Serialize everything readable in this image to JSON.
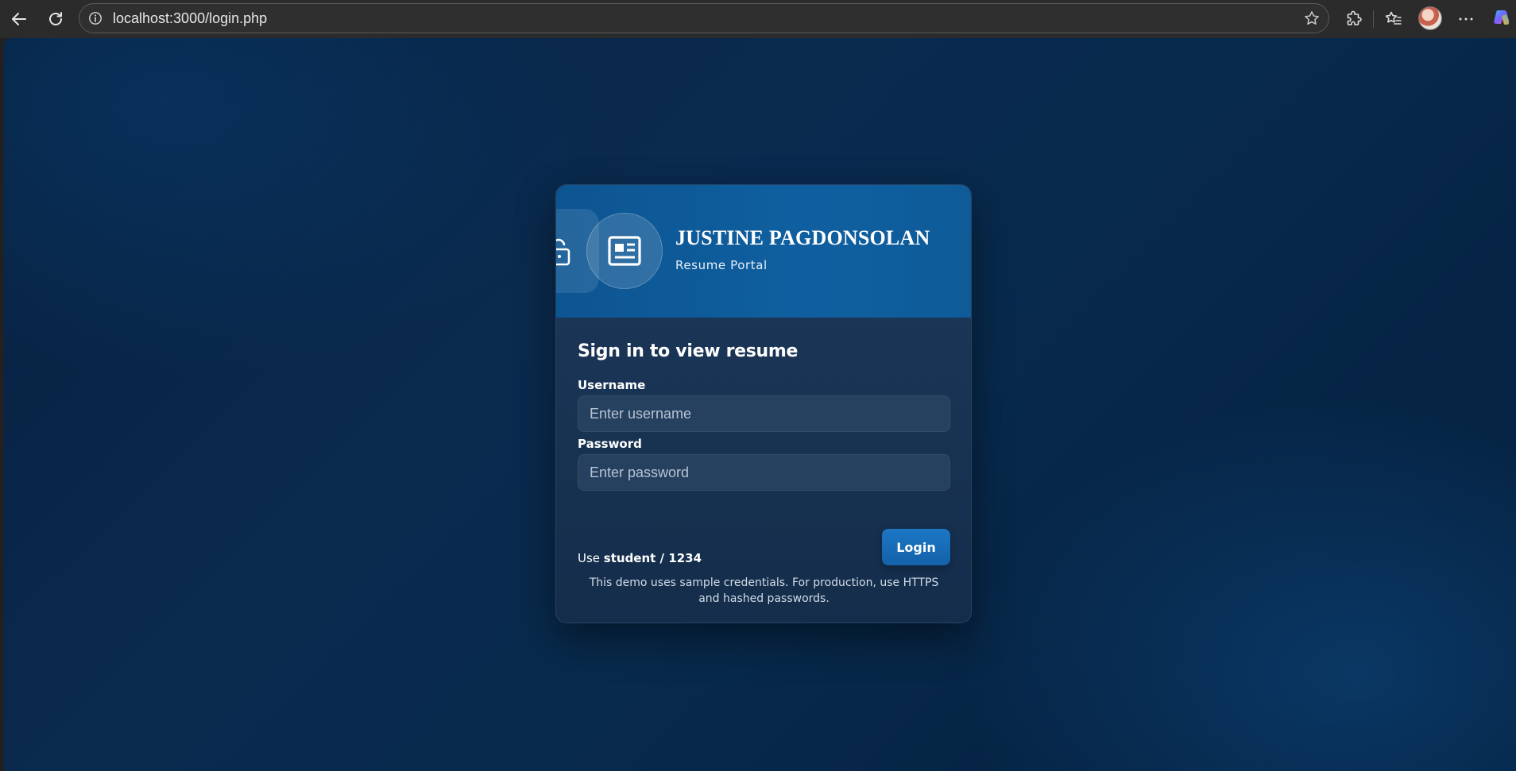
{
  "browser": {
    "url": "localhost:3000/login.php",
    "icons": {
      "back": "back-arrow-icon",
      "reload": "reload-icon",
      "info": "info-icon",
      "favorite": "star-icon",
      "extensions": "puzzle-icon",
      "favorites_list": "favorites-icon",
      "profile": "avatar",
      "menu": "more-icon",
      "copilot": "copilot-icon"
    }
  },
  "card": {
    "brand_name": "JUSTINE PAGDONSOLAN",
    "brand_sub": "Resume Portal",
    "form_title": "Sign in to view resume",
    "username": {
      "label": "Username",
      "placeholder": "Enter username",
      "value": ""
    },
    "password": {
      "label": "Password",
      "placeholder": "Enter password",
      "value": ""
    },
    "hint": {
      "prefix": "Use ",
      "credentials": "student / 1234"
    },
    "login_label": "Login",
    "note": "This demo uses sample credentials. For production, use HTTPS and hashed passwords."
  },
  "colors": {
    "header": "#0f5fa0",
    "body": "#15304f",
    "input": "#26405f",
    "button": "#1a6fb8",
    "page_bg": "#072549"
  }
}
